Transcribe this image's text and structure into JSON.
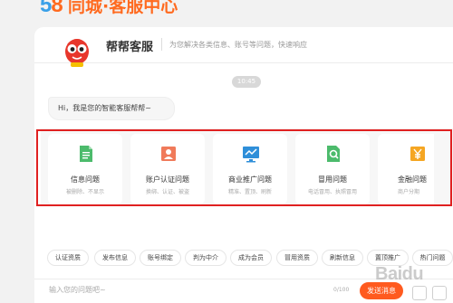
{
  "brand": {
    "logo_digits": [
      "5",
      "8"
    ],
    "title": "同城·客服中心"
  },
  "header": {
    "name": "帮帮客服",
    "tagline": "为您解决各类信息、账号等问题，快速响应"
  },
  "chat": {
    "time": "10:45",
    "greeting": "Hi，我是您的智能客服帮帮~"
  },
  "categories": [
    {
      "title": "信息问题",
      "subtitle": "被删除、不显示",
      "icon": "document-icon",
      "color": "#4cbb6c"
    },
    {
      "title": "账户认证问题",
      "subtitle": "换绑、认证、被盗",
      "icon": "id-card-icon",
      "color": "#f07a5a"
    },
    {
      "title": "商业推广问题",
      "subtitle": "精准、置顶、刷新",
      "icon": "trend-monitor-icon",
      "color": "#2f8fd9"
    },
    {
      "title": "冒用问题",
      "subtitle": "电话冒用、执照冒用",
      "icon": "search-doc-icon",
      "color": "#4cbb6c"
    },
    {
      "title": "金融问题",
      "subtitle": "商户分期",
      "icon": "yen-icon",
      "color": "#f5a623"
    }
  ],
  "quick_chips": [
    "认证资质",
    "发布信息",
    "账号绑定",
    "判为中介",
    "成为会员",
    "冒用资质",
    "刷新信息",
    "置顶推广",
    "热门问题"
  ],
  "input": {
    "placeholder": "输入您的问题吧~",
    "counter": "0/100",
    "send_label": "发送消息"
  },
  "watermark": "Baidu"
}
